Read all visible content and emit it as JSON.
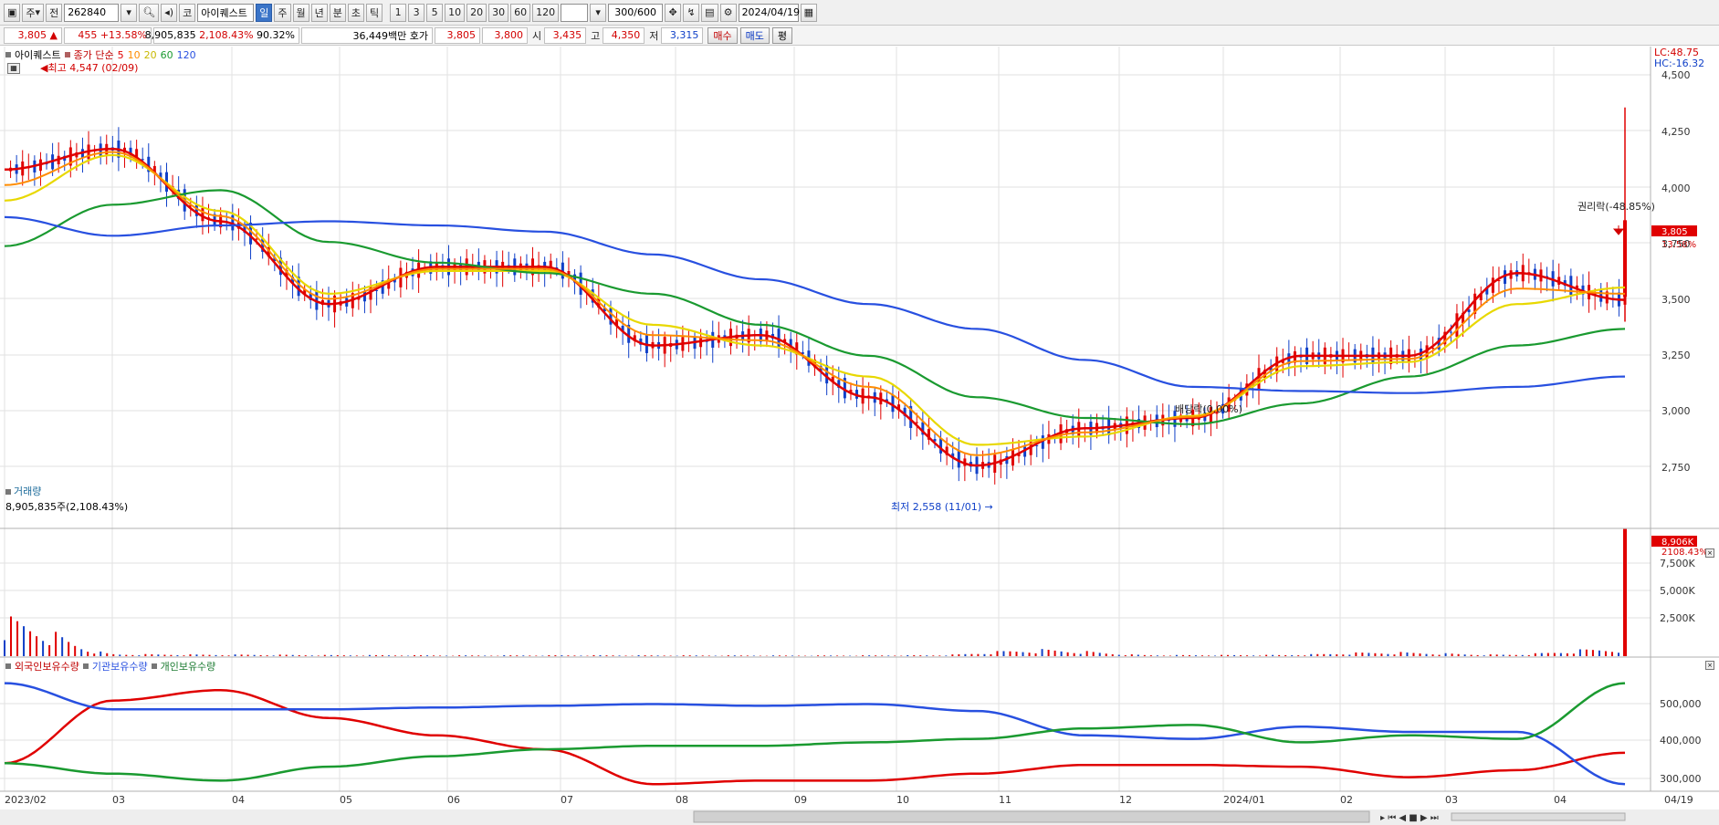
{
  "toolbar": {
    "period_code": "주",
    "prefix": "전",
    "stock_code": "262840",
    "stock_name": "아이퀘스트",
    "stock_badge": "코",
    "periods": [
      "일",
      "주",
      "월",
      "년",
      "분",
      "초",
      "틱"
    ],
    "intervals": [
      "1",
      "3",
      "5",
      "10",
      "20",
      "30",
      "60",
      "120"
    ],
    "count": "300/600",
    "date": "2024/04/19"
  },
  "quote": {
    "price": "3,805",
    "change": "455",
    "change_pct": "+13.58%",
    "volume": "8,905,835",
    "volume_ratio": "2,108.43%",
    "turnover": "90.32%",
    "amount": "36,449백만",
    "ask_label": "호가",
    "ask": "3,805",
    "bid": "3,800",
    "open_label": "시",
    "open": "3,435",
    "high_label": "고",
    "high": "4,350",
    "low_label": "저",
    "low": "3,315",
    "buy_label": "매수",
    "sell_label": "매도",
    "eval_label": "평"
  },
  "price_panel": {
    "legend_name": "아이퀘스트",
    "legend_ma": "종가 단순",
    "ma_periods": [
      "5",
      "10",
      "20",
      "60",
      "120"
    ],
    "ma_colors": [
      "#e00000",
      "#ff8c00",
      "#e8d800",
      "#1a9a30",
      "#2850e0"
    ],
    "lc": "LC:48.75",
    "hc": "HC:-16.32",
    "high_note": "최고 4,547 (02/09)",
    "low_note": "최저 2,558 (11/01)",
    "dividend_note": "배당락(0.00%)",
    "rights_note": "권리락(-48.85%)",
    "current_price_tag": "3,805",
    "current_pct_tag": "13.58%",
    "y_ticks": [
      "4,500",
      "4,250",
      "4,000",
      "3,750",
      "3,500",
      "3,250",
      "3,000",
      "2,750"
    ]
  },
  "volume_panel": {
    "title": "거래량",
    "subtitle": "8,905,835주(2,108.43%)",
    "tag": "8,906K",
    "tag_pct": "2108.43%",
    "y_ticks": [
      "7,500K",
      "5,000K",
      "2,500K"
    ]
  },
  "holding_panel": {
    "labels": [
      "외국인보유수량",
      "기관보유수량",
      "개인보유수량"
    ],
    "colors": [
      "#e00000",
      "#2850e0",
      "#1a9a30"
    ],
    "y_ticks": [
      "500,000",
      "400,000",
      "300,000"
    ]
  },
  "x_axis": {
    "labels": [
      "2023/02",
      "03",
      "04",
      "05",
      "06",
      "07",
      "08",
      "09",
      "10",
      "11",
      "12",
      "2024/01",
      "02",
      "03",
      "04"
    ],
    "end_label": "04/19"
  },
  "chart_data": {
    "type": "line",
    "x": [
      "2023/02",
      "03",
      "04",
      "05",
      "06",
      "07",
      "08",
      "09",
      "10",
      "11",
      "12",
      "2024/01",
      "02",
      "03",
      "04",
      "04/19"
    ],
    "series": [
      {
        "name": "5",
        "values": [
          4050,
          4150,
          3800,
          3400,
          3580,
          3580,
          3200,
          3250,
          2950,
          2620,
          2800,
          2850,
          3150,
          3150,
          3550,
          3420
        ]
      },
      {
        "name": "20",
        "values": [
          3900,
          4120,
          3850,
          3450,
          3560,
          3560,
          3300,
          3200,
          3050,
          2720,
          2760,
          2860,
          3100,
          3120,
          3400,
          3480
        ]
      },
      {
        "name": "60",
        "values": [
          3680,
          3880,
          3950,
          3700,
          3600,
          3550,
          3450,
          3300,
          3150,
          2950,
          2850,
          2820,
          2920,
          3050,
          3200,
          3280
        ]
      },
      {
        "name": "120",
        "values": [
          3820,
          3730,
          3780,
          3800,
          3780,
          3750,
          3640,
          3520,
          3400,
          3280,
          3130,
          3000,
          2980,
          2970,
          3000,
          3050
        ]
      }
    ],
    "ylim": [
      2550,
      4600
    ],
    "volume": {
      "x": [
        "2023/02",
        "03",
        "04",
        "05",
        "06",
        "07",
        "08",
        "09",
        "10",
        "11",
        "12",
        "2024/01",
        "02",
        "03",
        "04",
        "04/19"
      ],
      "values": [
        2800,
        150,
        120,
        80,
        60,
        70,
        60,
        50,
        70,
        500,
        80,
        90,
        300,
        120,
        600,
        8906
      ],
      "ylim": [
        0,
        8500
      ]
    },
    "holdings": [
      {
        "name": "외국인보유수량",
        "values": [
          350000,
          530000,
          560000,
          480000,
          430000,
          390000,
          290000,
          300000,
          300000,
          320000,
          345000,
          345000,
          340000,
          310000,
          330000,
          380000
        ]
      },
      {
        "name": "기관보유수량",
        "values": [
          580000,
          505000,
          505000,
          505000,
          510000,
          515000,
          520000,
          515000,
          520000,
          500000,
          430000,
          420000,
          455000,
          440000,
          440000,
          290000
        ]
      },
      {
        "name": "개인보유수량",
        "values": [
          350000,
          320000,
          300000,
          340000,
          370000,
          390000,
          400000,
          400000,
          410000,
          420000,
          450000,
          460000,
          410000,
          430000,
          420000,
          580000
        ]
      }
    ],
    "holdings_ylim": [
      280000,
      600000
    ]
  }
}
